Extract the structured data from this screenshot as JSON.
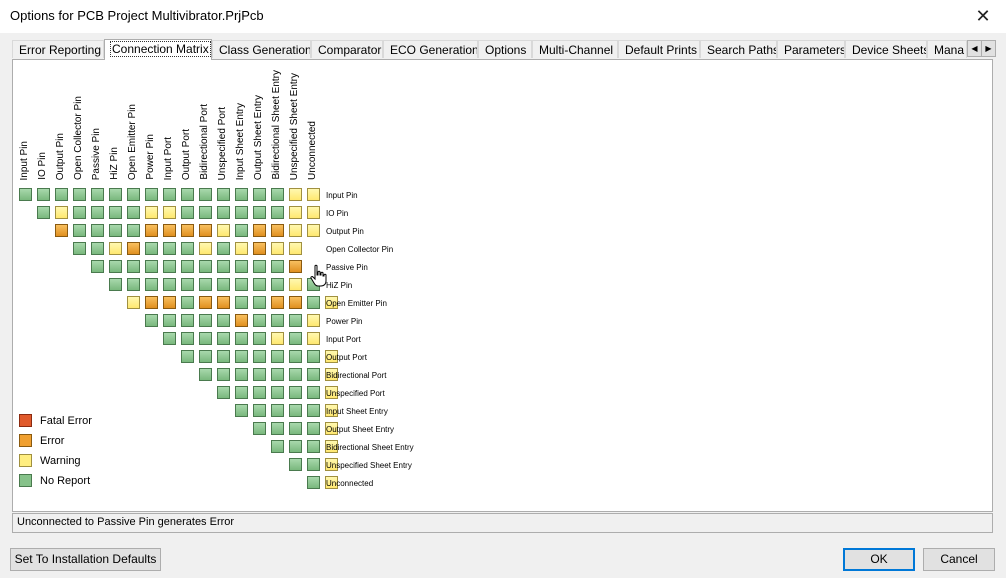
{
  "window": {
    "title": "Options for PCB Project Multivibrator.PrjPcb"
  },
  "tabs": [
    {
      "label": "Error Reporting",
      "active": false
    },
    {
      "label": "Connection Matrix",
      "active": true
    },
    {
      "label": "Class Generation",
      "active": false
    },
    {
      "label": "Comparator",
      "active": false
    },
    {
      "label": "ECO Generation",
      "active": false
    },
    {
      "label": "Options",
      "active": false
    },
    {
      "label": "Multi-Channel",
      "active": false
    },
    {
      "label": "Default Prints",
      "active": false
    },
    {
      "label": "Search Paths",
      "active": false
    },
    {
      "label": "Parameters",
      "active": false
    },
    {
      "label": "Device Sheets",
      "active": false
    },
    {
      "label": "Mana",
      "active": false
    }
  ],
  "matrix": {
    "pin_types": [
      "Input Pin",
      "IO Pin",
      "Output Pin",
      "Open Collector Pin",
      "Passive Pin",
      "HiZ Pin",
      "Open Emitter Pin",
      "Power Pin",
      "Input Port",
      "Output Port",
      "Bidirectional Port",
      "Unspecified Port",
      "Input Sheet Entry",
      "Output Sheet Entry",
      "Bidirectional Sheet Entry",
      "Unspecified Sheet Entry",
      "Unconnected"
    ],
    "codes": [
      "NNNNNNNNNNNNNNNWW",
      "NWNNNNWWNNNNNNWW",
      "ENNNNEEEEWNEEWW",
      "NNWENNNWNWEWW",
      "NNNNNNNNNNNE",
      "NNNNNNNNNNWN",
      "WEENEENNEENW",
      "NNNNNENNNW",
      "NNNNNNWNW",
      "NNNNNNNNW",
      "NNNNNNNW",
      "NNNNNNW",
      "NNNNNW",
      "NNNNW",
      "NNNW",
      "NNW",
      "NW"
    ],
    "cursor_cell": {
      "row": 4,
      "col": 16
    }
  },
  "legend": [
    {
      "label": "Fatal Error",
      "color": "#e05a2b"
    },
    {
      "label": "Error",
      "color": "#f0a030"
    },
    {
      "label": "Warning",
      "color": "#ffee80"
    },
    {
      "label": "No Report",
      "color": "#86c28a"
    }
  ],
  "status": "Unconnected to Passive Pin generates Error",
  "buttons": {
    "defaults": "Set To Installation Defaults",
    "ok": "OK",
    "cancel": "Cancel"
  }
}
